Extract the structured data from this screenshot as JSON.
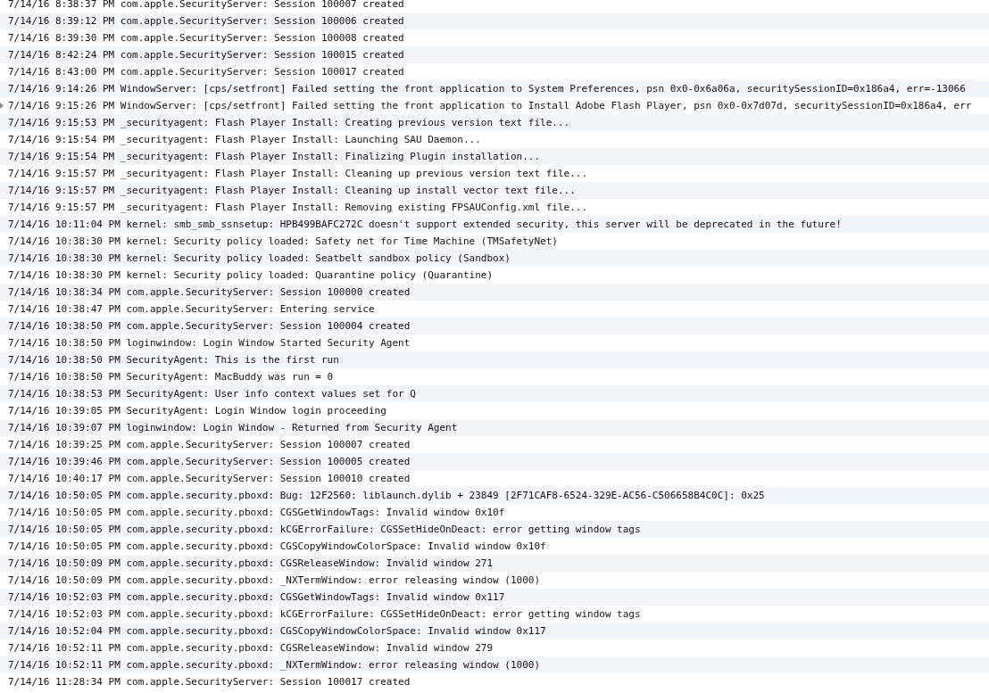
{
  "log": {
    "rows": [
      {
        "line": "7/14/16 8:38:37 PM com.apple.SecurityServer: Session 100007 created",
        "expandable": false
      },
      {
        "line": "7/14/16 8:39:12 PM com.apple.SecurityServer: Session 100006 created",
        "expandable": false
      },
      {
        "line": "7/14/16 8:39:30 PM com.apple.SecurityServer: Session 100008 created",
        "expandable": false
      },
      {
        "line": "7/14/16 8:42:24 PM com.apple.SecurityServer: Session 100015 created",
        "expandable": false
      },
      {
        "line": "7/14/16 8:43:00 PM com.apple.SecurityServer: Session 100017 created",
        "expandable": false
      },
      {
        "line": "7/14/16 9:14:26 PM WindowServer: [cps/setfront] Failed setting the front application to System Preferences, psn 0x0-0x6a06a, securitySessionID=0x186a4, err=-13066",
        "expandable": false
      },
      {
        "line": "7/14/16 9:15:26 PM WindowServer: [cps/setfront] Failed setting the front application to Install Adobe Flash Player, psn 0x0-0x7d07d, securitySessionID=0x186a4, err",
        "expandable": true
      },
      {
        "line": "7/14/16 9:15:53 PM _securityagent: Flash Player Install: Creating previous version text file...",
        "expandable": false
      },
      {
        "line": "7/14/16 9:15:54 PM _securityagent: Flash Player Install: Launching SAU Daemon...",
        "expandable": false
      },
      {
        "line": "7/14/16 9:15:54 PM _securityagent: Flash Player Install: Finalizing Plugin installation...",
        "expandable": false
      },
      {
        "line": "7/14/16 9:15:57 PM _securityagent: Flash Player Install: Cleaning up previous version text file...",
        "expandable": false
      },
      {
        "line": "7/14/16 9:15:57 PM _securityagent: Flash Player Install: Cleaning up install vector text file...",
        "expandable": false
      },
      {
        "line": "7/14/16 9:15:57 PM _securityagent: Flash Player Install: Removing existing FPSAUConfig.xml file...",
        "expandable": false
      },
      {
        "line": "7/14/16 10:11:04 PM kernel: smb_smb_ssnsetup: HPB499BAFC272C doesn't support extended security, this server will be deprecated in the future!",
        "expandable": false
      },
      {
        "line": "7/14/16 10:38:30 PM kernel: Security policy loaded: Safety net for Time Machine (TMSafetyNet)",
        "expandable": false
      },
      {
        "line": "7/14/16 10:38:30 PM kernel: Security policy loaded: Seatbelt sandbox policy (Sandbox)",
        "expandable": false
      },
      {
        "line": "7/14/16 10:38:30 PM kernel: Security policy loaded: Quarantine policy (Quarantine)",
        "expandable": false
      },
      {
        "line": "7/14/16 10:38:34 PM com.apple.SecurityServer: Session 100000 created",
        "expandable": false
      },
      {
        "line": "7/14/16 10:38:47 PM com.apple.SecurityServer: Entering service",
        "expandable": false
      },
      {
        "line": "7/14/16 10:38:50 PM com.apple.SecurityServer: Session 100004 created",
        "expandable": false
      },
      {
        "line": "7/14/16 10:38:50 PM loginwindow: Login Window Started Security Agent",
        "expandable": false
      },
      {
        "line": "7/14/16 10:38:50 PM SecurityAgent: This is the first run",
        "expandable": false
      },
      {
        "line": "7/14/16 10:38:50 PM SecurityAgent: MacBuddy was run = 0",
        "expandable": false
      },
      {
        "line": "7/14/16 10:38:53 PM SecurityAgent: User info context values set for Q",
        "expandable": false
      },
      {
        "line": "7/14/16 10:39:05 PM SecurityAgent: Login Window login proceeding",
        "expandable": false
      },
      {
        "line": "7/14/16 10:39:07 PM loginwindow: Login Window - Returned from Security Agent",
        "expandable": false
      },
      {
        "line": "7/14/16 10:39:25 PM com.apple.SecurityServer: Session 100007 created",
        "expandable": false
      },
      {
        "line": "7/14/16 10:39:46 PM com.apple.SecurityServer: Session 100005 created",
        "expandable": false
      },
      {
        "line": "7/14/16 10:40:17 PM com.apple.SecurityServer: Session 100010 created",
        "expandable": false
      },
      {
        "line": "7/14/16 10:50:05 PM com.apple.security.pboxd: Bug: 12F2560: liblaunch.dylib + 23849 [2F71CAF8-6524-329E-AC56-C506658B4C0C]: 0x25",
        "expandable": false
      },
      {
        "line": "7/14/16 10:50:05 PM com.apple.security.pboxd: CGSGetWindowTags: Invalid window 0x10f",
        "expandable": false
      },
      {
        "line": "7/14/16 10:50:05 PM com.apple.security.pboxd: kCGErrorFailure: CGSSetHideOnDeact: error getting window tags",
        "expandable": false
      },
      {
        "line": "7/14/16 10:50:05 PM com.apple.security.pboxd: CGSCopyWindowColorSpace: Invalid window 0x10f",
        "expandable": false
      },
      {
        "line": "7/14/16 10:50:09 PM com.apple.security.pboxd: CGSReleaseWindow: Invalid window 271",
        "expandable": false
      },
      {
        "line": "7/14/16 10:50:09 PM com.apple.security.pboxd: _NXTermWindow: error releasing window (1000)",
        "expandable": false
      },
      {
        "line": "7/14/16 10:52:03 PM com.apple.security.pboxd: CGSGetWindowTags: Invalid window 0x117",
        "expandable": false
      },
      {
        "line": "7/14/16 10:52:03 PM com.apple.security.pboxd: kCGErrorFailure: CGSSetHideOnDeact: error getting window tags",
        "expandable": false
      },
      {
        "line": "7/14/16 10:52:04 PM com.apple.security.pboxd: CGSCopyWindowColorSpace: Invalid window 0x117",
        "expandable": false
      },
      {
        "line": "7/14/16 10:52:11 PM com.apple.security.pboxd: CGSReleaseWindow: Invalid window 279",
        "expandable": false
      },
      {
        "line": "7/14/16 10:52:11 PM com.apple.security.pboxd: _NXTermWindow: error releasing window (1000)",
        "expandable": false
      },
      {
        "line": "7/14/16 11:28:34 PM com.apple.SecurityServer: Session 100017 created",
        "expandable": false
      }
    ]
  }
}
